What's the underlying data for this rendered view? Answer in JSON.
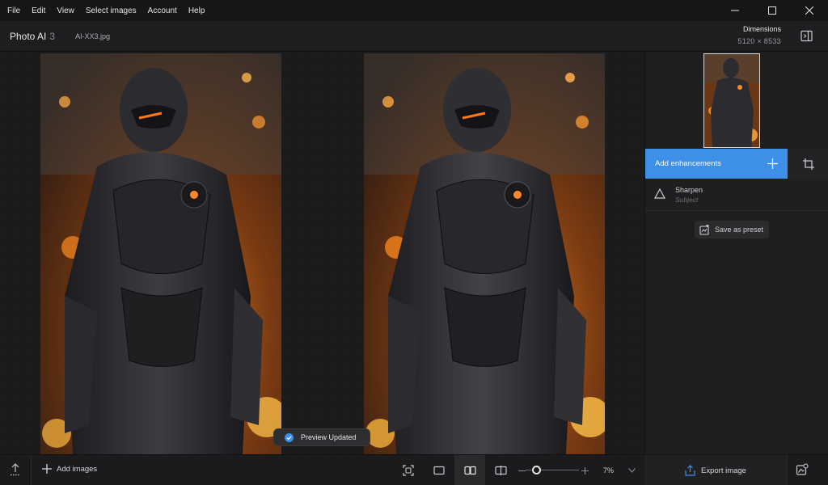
{
  "menu": [
    "File",
    "Edit",
    "View",
    "Select images",
    "Account",
    "Help"
  ],
  "header": {
    "app_name": "Photo AI",
    "app_version": "3",
    "filename": "AI-XX3.jpg",
    "dimensions_label": "Dimensions",
    "dimensions_value": "5120 × 8533"
  },
  "canvas": {
    "toast": "Preview Updated"
  },
  "sidebar": {
    "add_enhancements": "Add enhancements",
    "enhancements": [
      {
        "name": "Sharpen",
        "subtitle": "Subject"
      }
    ],
    "save_preset": "Save as preset"
  },
  "bottombar": {
    "add_images": "Add images",
    "zoom": "7%",
    "zoom_fraction": 0.2,
    "export": "Export image"
  },
  "colors": {
    "accent": "#3d8fe8",
    "background": "#1a1a1b"
  }
}
